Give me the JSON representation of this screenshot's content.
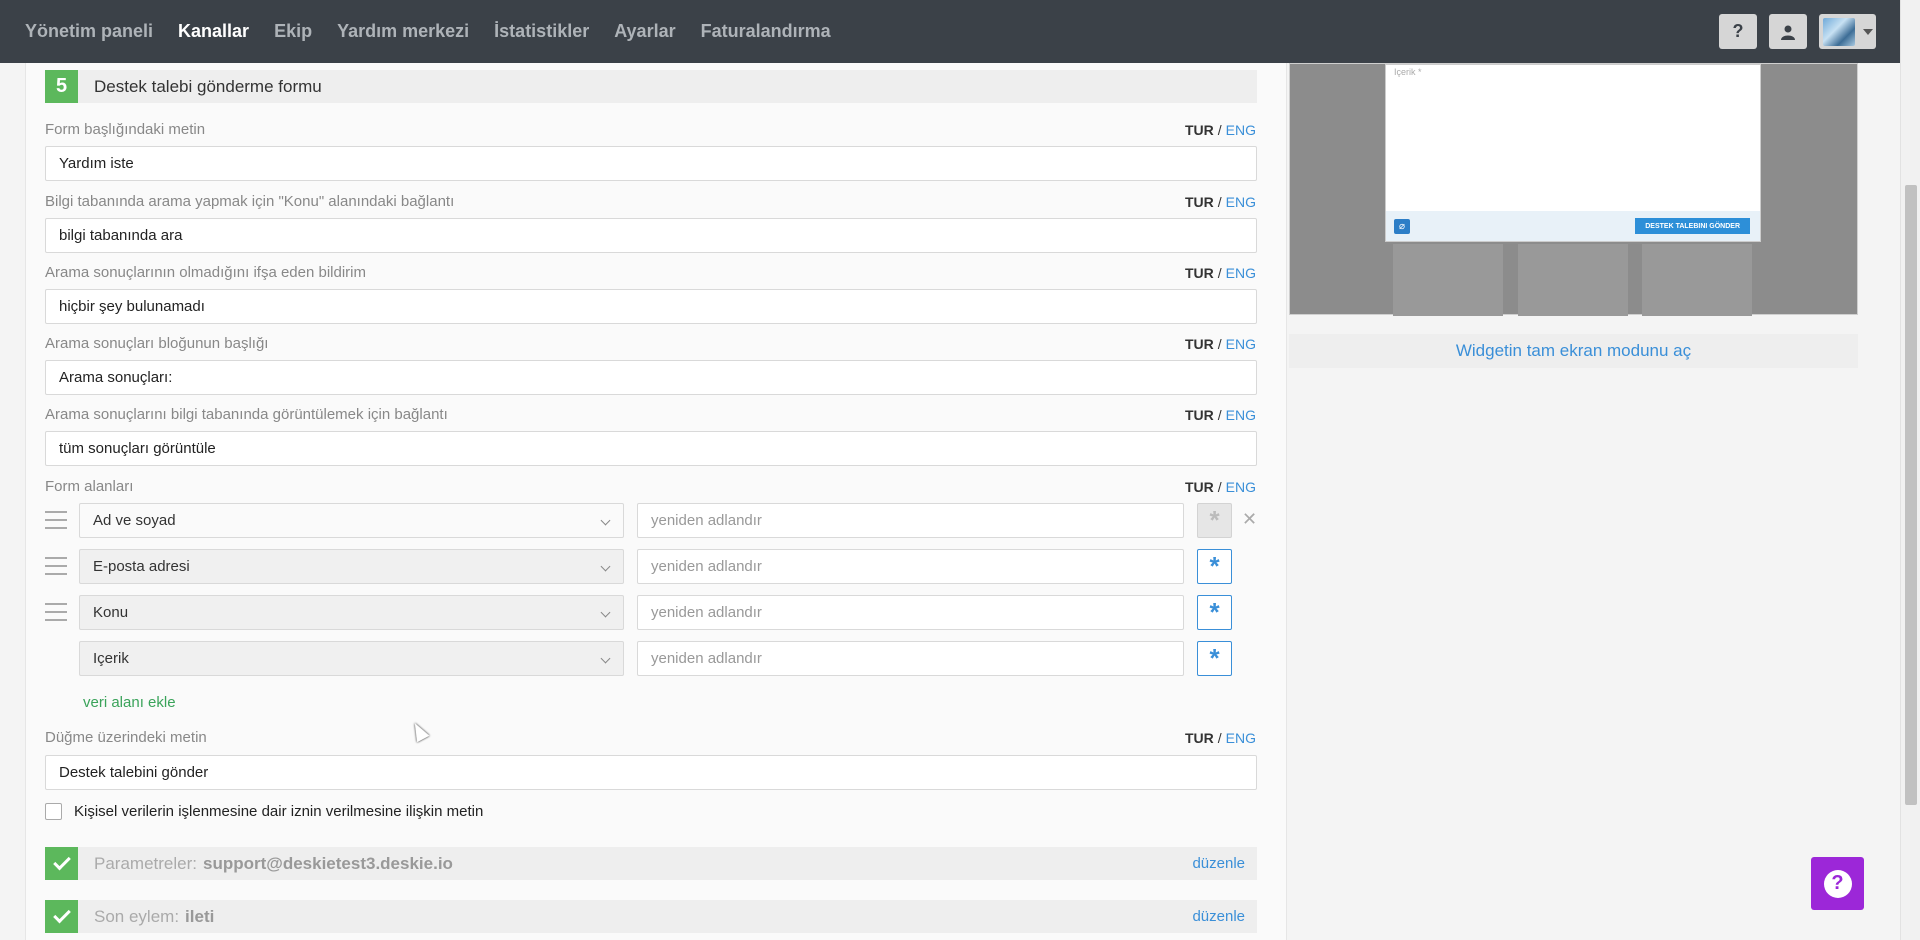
{
  "nav": {
    "items": [
      {
        "label": "Yönetim paneli",
        "active": false
      },
      {
        "label": "Kanallar",
        "active": true
      },
      {
        "label": "Ekip",
        "active": false
      },
      {
        "label": "Yardım merkezi",
        "active": false
      },
      {
        "label": "İstatistikler",
        "active": false
      },
      {
        "label": "Ayarlar",
        "active": false
      },
      {
        "label": "Faturalandırma",
        "active": false
      }
    ],
    "help_icon": "?"
  },
  "step": {
    "number": "5",
    "title": "Destek talebi gönderme formu"
  },
  "lang": {
    "tur": "TUR",
    "sep": "/",
    "eng": "ENG"
  },
  "fields": [
    {
      "label": "Form başlığındaki metin",
      "value": "Yardım iste"
    },
    {
      "label": "Bilgi tabanında arama yapmak için \"Konu\" alanındaki bağlantı",
      "value": "bilgi tabanında ara"
    },
    {
      "label": "Arama sonuçlarının olmadığını ifşa eden bildirim",
      "value": "hiçbir şey bulunamadı"
    },
    {
      "label": "Arama sonuçları bloğunun başlığı",
      "value": "Arama sonuçları:"
    },
    {
      "label": "Arama sonuçlarını bilgi tabanında görüntülemek için bağlantı",
      "value": "tüm sonuçları görüntüle"
    }
  ],
  "form_fields": {
    "label": "Form alanları",
    "rename_placeholder": "yeniden adlandır",
    "rows": [
      {
        "select": "Ad ve soyad",
        "required": false
      },
      {
        "select": "E-posta adresi",
        "required": true
      },
      {
        "select": "Konu",
        "required": true
      },
      {
        "select": "Içerik",
        "required": true
      }
    ],
    "add_label": "veri alanı ekle"
  },
  "button_text": {
    "label": "Düğme üzerindeki metin",
    "value": "Destek talebini gönder"
  },
  "consent": {
    "label": "Kişisel verilerin işlenmesine dair iznin verilmesine ilişkin metin",
    "checked": false
  },
  "completed": [
    {
      "label": "Parametreler:",
      "value": "support@deskietest3.deskie.io",
      "edit": "düzenle"
    },
    {
      "label": "Son eylem:",
      "value": "ileti",
      "edit": "düzenle"
    }
  ],
  "preview": {
    "content_label": "Içerik *",
    "send_button": "DESTEK TALEBINI GÖNDER",
    "fullscreen_link": "Widgetin tam ekran modunu aç"
  },
  "colors": {
    "accent": "#3a8fd8",
    "success": "#5cb85c",
    "nav_bg": "#3b4148",
    "help_float": "#9c27d8"
  }
}
